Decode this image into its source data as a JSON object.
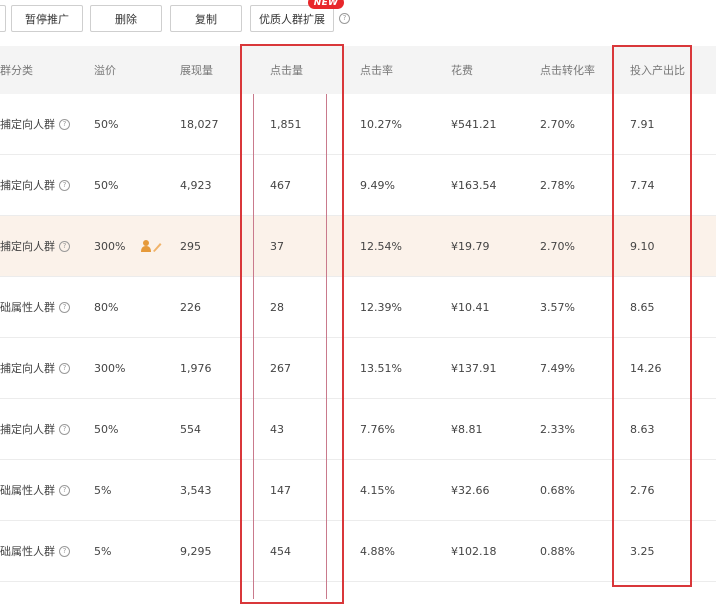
{
  "toolbar": {
    "pause_label": "暂停推广",
    "delete_label": "删除",
    "copy_label": "复制",
    "expand_label": "优质人群扩展",
    "new_badge": "NEW",
    "help_glyph": "?"
  },
  "table": {
    "headers": [
      "群分类",
      "溢价",
      "展现量",
      "点击量",
      "点击率",
      "花费",
      "点击转化率",
      "投入产出比"
    ],
    "rows": [
      {
        "category": "捕定向人群",
        "premium": "50%",
        "impressions": "18,027",
        "clicks": "1,851",
        "ctr": "10.27%",
        "cost": "¥541.21",
        "cvr": "2.70%",
        "roi": "7.91"
      },
      {
        "category": "捕定向人群",
        "premium": "50%",
        "impressions": "4,923",
        "clicks": "467",
        "ctr": "9.49%",
        "cost": "¥163.54",
        "cvr": "2.78%",
        "roi": "7.74"
      },
      {
        "category": "捕定向人群",
        "premium": "300%",
        "impressions": "295",
        "clicks": "37",
        "ctr": "12.54%",
        "cost": "¥19.79",
        "cvr": "2.70%",
        "roi": "9.10"
      },
      {
        "category": "础属性人群",
        "premium": "80%",
        "impressions": "226",
        "clicks": "28",
        "ctr": "12.39%",
        "cost": "¥10.41",
        "cvr": "3.57%",
        "roi": "8.65"
      },
      {
        "category": "捕定向人群",
        "premium": "300%",
        "impressions": "1,976",
        "clicks": "267",
        "ctr": "13.51%",
        "cost": "¥137.91",
        "cvr": "7.49%",
        "roi": "14.26"
      },
      {
        "category": "捕定向人群",
        "premium": "50%",
        "impressions": "554",
        "clicks": "43",
        "ctr": "7.76%",
        "cost": "¥8.81",
        "cvr": "2.33%",
        "roi": "8.63"
      },
      {
        "category": "础属性人群",
        "premium": "5%",
        "impressions": "3,543",
        "clicks": "147",
        "ctr": "4.15%",
        "cost": "¥32.66",
        "cvr": "0.68%",
        "roi": "2.76"
      },
      {
        "category": "础属性人群",
        "premium": "5%",
        "impressions": "9,295",
        "clicks": "454",
        "ctr": "4.88%",
        "cost": "¥102.18",
        "cvr": "0.88%",
        "roi": "3.25"
      }
    ]
  },
  "highlight_row_index": 2,
  "colors": {
    "annotation_red": "#d9373a",
    "highlight_row": "#fbf2ea",
    "header_bg": "#f4f4f4",
    "badge_red": "#e8262a"
  }
}
